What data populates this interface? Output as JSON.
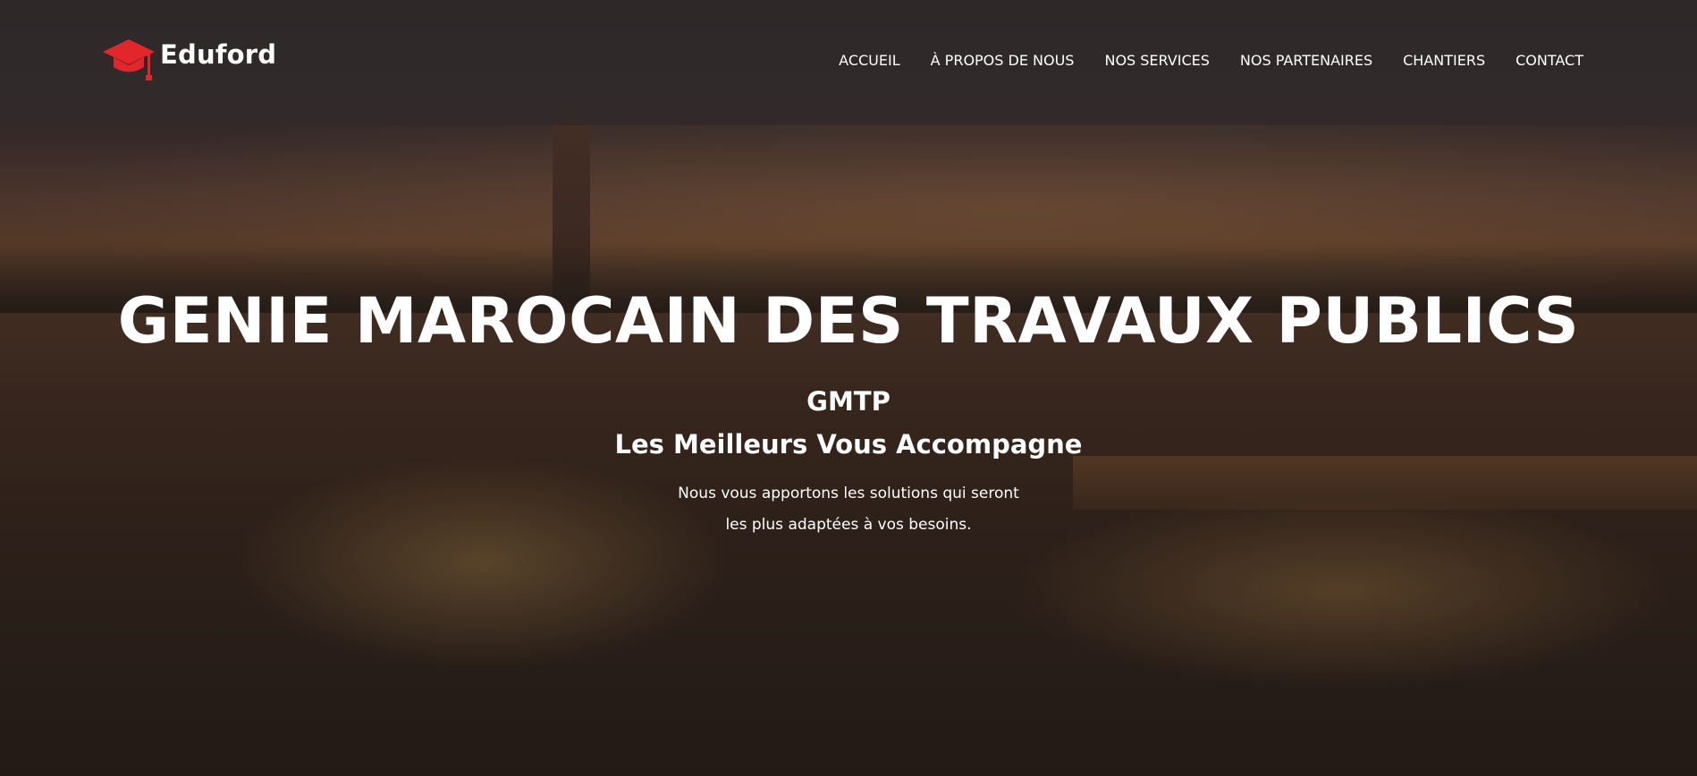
{
  "brand": {
    "name": "Eduford",
    "icon": "graduation-cap-icon",
    "icon_color": "#e3262b"
  },
  "nav": {
    "items": [
      {
        "label": "ACCUEIL"
      },
      {
        "label": "À PROPOS DE NOUS"
      },
      {
        "label": "NOS SERVICES"
      },
      {
        "label": "NOS PARTENAIRES"
      },
      {
        "label": "CHANTIERS"
      },
      {
        "label": "CONTACT"
      }
    ]
  },
  "hero": {
    "title": "GENIE MAROCAIN DES TRAVAUX PUBLICS",
    "acronym": "GMTP",
    "tagline": "Les Meilleurs Vous Accompagne",
    "description_line1": "Nous vous apportons les solutions qui seront",
    "description_line2": "les plus adaptées à vos besoins.",
    "background": "marrakech-square-night-image"
  },
  "colors": {
    "header_bg": "#322c2c",
    "text": "#ffffff",
    "accent": "#e3262b"
  }
}
